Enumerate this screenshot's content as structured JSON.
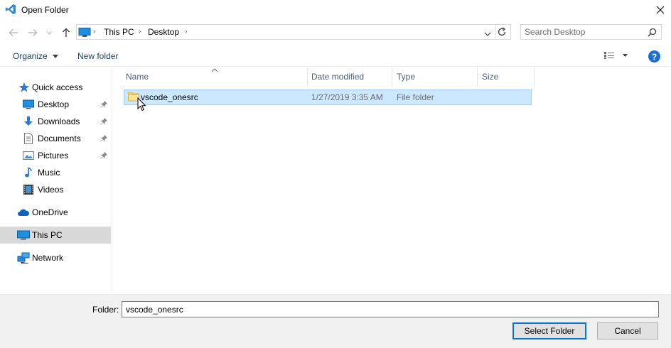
{
  "window": {
    "title": "Open Folder"
  },
  "address": {
    "crumbs": [
      "This PC",
      "Desktop"
    ],
    "search_placeholder": "Search Desktop"
  },
  "toolbar": {
    "organize_label": "Organize",
    "new_folder_label": "New folder"
  },
  "navpane": {
    "items": [
      {
        "label": "Quick access",
        "icon": "star-icon"
      },
      {
        "label": "Desktop",
        "icon": "desktop-icon",
        "pinned": true
      },
      {
        "label": "Downloads",
        "icon": "download-arrow-icon",
        "pinned": true
      },
      {
        "label": "Documents",
        "icon": "document-icon",
        "pinned": true
      },
      {
        "label": "Pictures",
        "icon": "picture-icon",
        "pinned": true
      },
      {
        "label": "Music",
        "icon": "music-note-icon"
      },
      {
        "label": "Videos",
        "icon": "film-icon"
      },
      {
        "label": "OneDrive",
        "icon": "cloud-icon"
      },
      {
        "label": "This PC",
        "icon": "computer-icon",
        "selected": true
      },
      {
        "label": "Network",
        "icon": "network-icon"
      }
    ]
  },
  "filelist": {
    "columns": [
      "Name",
      "Date modified",
      "Type",
      "Size"
    ],
    "rows": [
      {
        "name": "vscode_onesrc",
        "date_modified": "1/27/2019 3:35 AM",
        "type": "File folder",
        "size": ""
      }
    ]
  },
  "bottom": {
    "folder_label": "Folder:",
    "folder_value": "vscode_onesrc",
    "select_button": "Select Folder",
    "cancel_button": "Cancel"
  },
  "colors": {
    "accent": "#0078d7",
    "selection_bg": "#cce8ff",
    "selection_border": "#99d1ff",
    "help_blue": "#1d6fd5"
  }
}
